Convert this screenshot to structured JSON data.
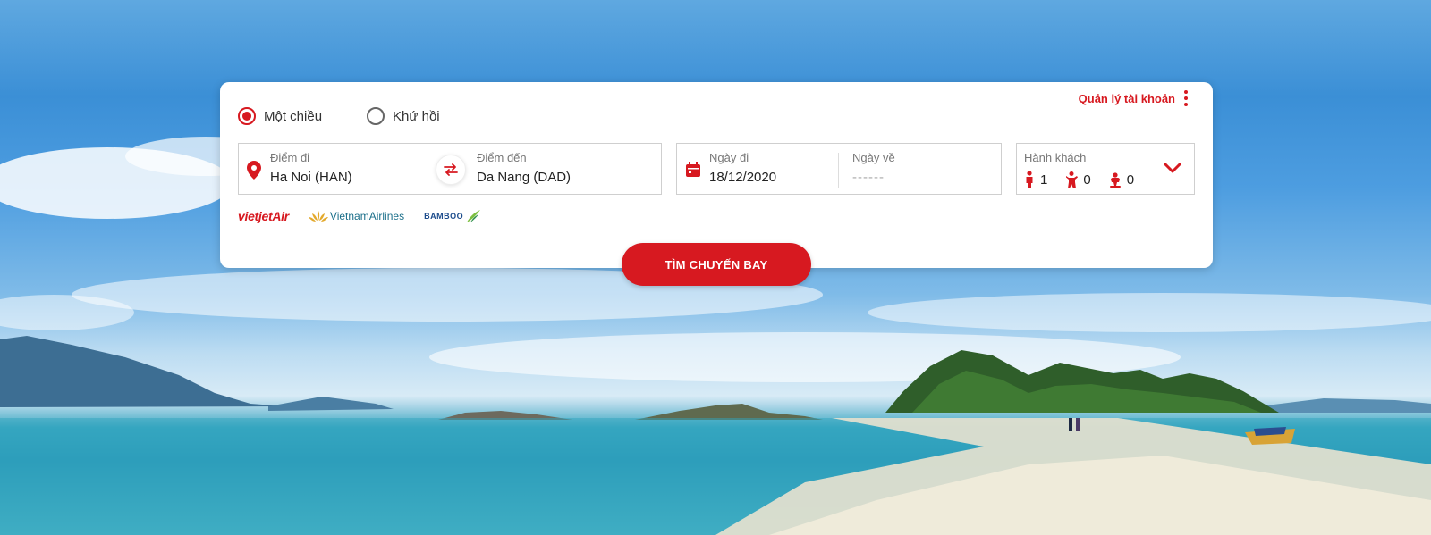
{
  "account": {
    "label": "Quản lý tài khoản"
  },
  "trip_type": {
    "options": [
      {
        "label": "Một chiều",
        "selected": true
      },
      {
        "label": "Khứ hồi",
        "selected": false
      }
    ]
  },
  "route": {
    "from_label": "Điểm đi",
    "from_value": "Ha Noi (HAN)",
    "to_label": "Điểm đến",
    "to_value": "Da Nang (DAD)"
  },
  "dates": {
    "depart_label": "Ngày đi",
    "depart_value": "18/12/2020",
    "return_label": "Ngày về",
    "return_value": "------"
  },
  "passengers": {
    "label": "Hành khách",
    "adults": "1",
    "children": "0",
    "infants": "0"
  },
  "airlines": {
    "vietjet": "vietjetAir",
    "vietnam": "VietnamAirlines",
    "bamboo": "BAMBOO"
  },
  "search_button": {
    "label": "TÌM CHUYẾN BAY"
  },
  "colors": {
    "accent": "#d71920"
  },
  "icons": [
    "kebab-menu-icon",
    "location-pin-icon",
    "swap-icon",
    "calendar-icon",
    "adult-icon",
    "child-icon",
    "infant-icon",
    "chevron-down-icon",
    "lotus-icon",
    "bamboo-leaf-icon"
  ]
}
